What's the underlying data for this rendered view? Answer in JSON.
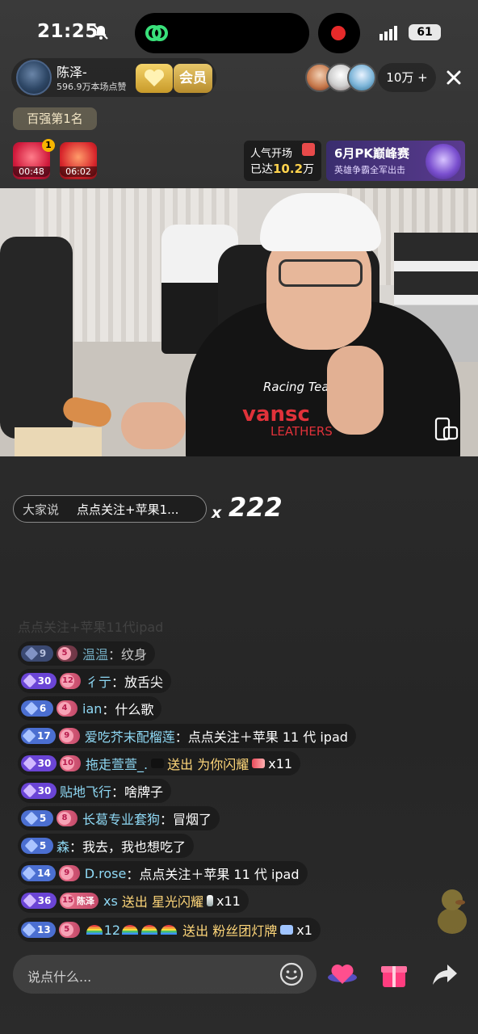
{
  "status_bar": {
    "time": "21:25",
    "battery": "61"
  },
  "host": {
    "name": "陈泽-",
    "likes": "596.9万本场点赞",
    "vip_label": "会员"
  },
  "viewers": {
    "count": "10万 +"
  },
  "rank_badge": "百强第1名",
  "gift_timers": [
    {
      "time": "00:48",
      "count": "1"
    },
    {
      "time": "06:02"
    }
  ],
  "popularity": {
    "title": "人气开场",
    "prefix": "已达",
    "value": "10.2",
    "unit": "万"
  },
  "pk_event": {
    "title": "6月PK巅峰赛",
    "subtitle": "英雄争霸全军出击"
  },
  "video_overlay": {
    "logo_main": "vansc",
    "logo_script": "Racing Team",
    "logo_sub": "LEATHERS"
  },
  "combo": {
    "prefix": "大家说",
    "text": "点点关注+苹果1...",
    "x": "x",
    "count": "222"
  },
  "chat": {
    "faded": "点点关注+苹果11代ipad",
    "messages": [
      {
        "level": "9",
        "level_style": "blue",
        "fan": "5",
        "user": "温温",
        "sep": "：",
        "text": "纹身"
      },
      {
        "level": "30",
        "level_style": "purple",
        "fan": "12",
        "user": "彳亍",
        "sep": "：",
        "text": "放舌尖"
      },
      {
        "level": "6",
        "level_style": "blue",
        "fan": "4",
        "user": "ian",
        "sep": "：",
        "text": "什么歌"
      },
      {
        "level": "17",
        "level_style": "blue",
        "fan": "9",
        "user": "爱吃芥末配榴莲",
        "sep": "：",
        "text": "点点关注＋苹果 11 代 ipad"
      },
      {
        "level": "30",
        "level_style": "purple",
        "fan": "10",
        "user": "拖走萱萱_.",
        "action": "送出",
        "gift": "为你闪耀",
        "qty": "x11"
      },
      {
        "level": "30",
        "level_style": "purple",
        "user": "贴地飞行",
        "sep": "：",
        "text": "啥牌子"
      },
      {
        "level": "5",
        "level_style": "blue",
        "fan": "8",
        "user": "长葛专业套狗",
        "sep": "：",
        "text": "冒烟了"
      },
      {
        "level": "5",
        "level_style": "blue",
        "user": "森",
        "sep": "：",
        "text": "我去，我也想吃了"
      },
      {
        "level": "14",
        "level_style": "blue",
        "fan": "9",
        "user": "D.rose",
        "sep": "：",
        "text": "点点关注＋苹果 11 代 ipad"
      },
      {
        "level": "36",
        "level_style": "purple",
        "fan": "15",
        "fan_name": "陈泽",
        "user": "xs",
        "action": "送出",
        "gift": "星光闪耀",
        "qty": "x11"
      },
      {
        "level": "13",
        "level_style": "blue",
        "fan": "5",
        "user": "12",
        "action": "送出",
        "gift": "粉丝团灯牌",
        "qty": "x1"
      }
    ]
  },
  "bottom_bar": {
    "input_placeholder": "说点什么..."
  },
  "colors": {
    "accent_red": "#e62a2a",
    "username": "#8fd9f5",
    "gift_text": "#ffd77a",
    "popularity_num": "#ffd34d"
  }
}
